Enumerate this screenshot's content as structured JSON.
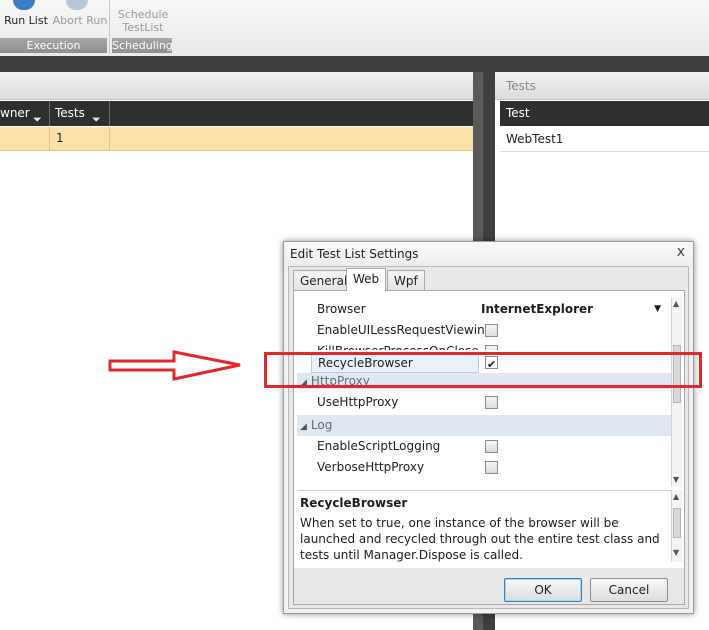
{
  "ribbon": {
    "run_list": "Run List",
    "abort_run": "Abort Run",
    "schedule_testlist": "Schedule TestList",
    "group_execution": "Execution",
    "group_scheduling": "Scheduling"
  },
  "left_grid": {
    "col_owner": "wner",
    "col_tests": "Tests",
    "row_tests_value": "1"
  },
  "right_panel": {
    "header": "Tests",
    "col_test": "Test",
    "row_test": "WebTest1"
  },
  "dialog": {
    "title": "Edit Test List Settings",
    "close_glyph": "x",
    "tabs": [
      "General",
      "Web",
      "Wpf"
    ],
    "active_tab": "Web",
    "properties": {
      "browser_label": "Browser",
      "browser_value": "InternetExplorer",
      "enable_ui_less_label": "EnableUILessRequestViewing",
      "kill_browser_label": "KillBrowserProcessOnClose",
      "recycle_browser_label": "RecycleBrowser",
      "recycle_browser_checked": true,
      "cat_httpproxy": "HttpProxy",
      "use_httpproxy_label": "UseHttpProxy",
      "cat_log": "Log",
      "enable_script_logging_label": "EnableScriptLogging",
      "verbose_httpproxy_label": "VerboseHttpProxy"
    },
    "description": {
      "title": "RecycleBrowser",
      "text": "When set to true, one instance of the browser will be launched and recycled through out the entire test class and tests until Manager.Dispose is called."
    },
    "ok": "OK",
    "cancel": "Cancel"
  },
  "colors": {
    "selected_row": "#fde2a8",
    "header_dark": "#2f2f2f",
    "annotation_red": "#e0282e"
  }
}
